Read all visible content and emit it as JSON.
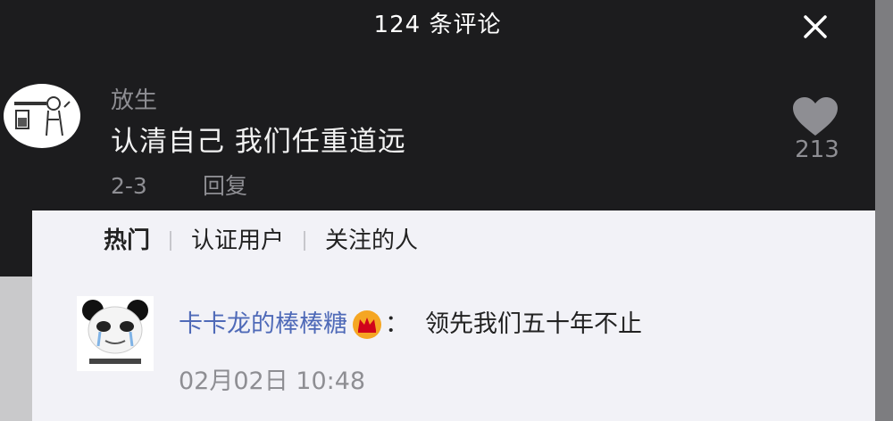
{
  "header": {
    "title": "124 条评论",
    "close_icon": "close-icon"
  },
  "comment_top": {
    "username": "放生",
    "text": "认清自己 我们任重道远",
    "date": "2-3",
    "reply_label": "回复",
    "like_count": "213",
    "like_icon": "heart-icon"
  },
  "tabs": [
    {
      "label": "热门",
      "active": true
    },
    {
      "label": "认证用户",
      "active": false
    },
    {
      "label": "关注的人",
      "active": false
    }
  ],
  "comment_bottom": {
    "username": "卡卡龙的棒棒糖",
    "badge_icon": "crown-icon",
    "separator": "：",
    "text": "领先我们五十年不止",
    "timestamp": "02月02日 10:48"
  },
  "colors": {
    "dark_bg": "#1c1c1e",
    "light_bg": "#f2f2f7",
    "username_link": "#4f6ab8",
    "crown": "#f5a623",
    "muted_text": "#8e8e93"
  }
}
